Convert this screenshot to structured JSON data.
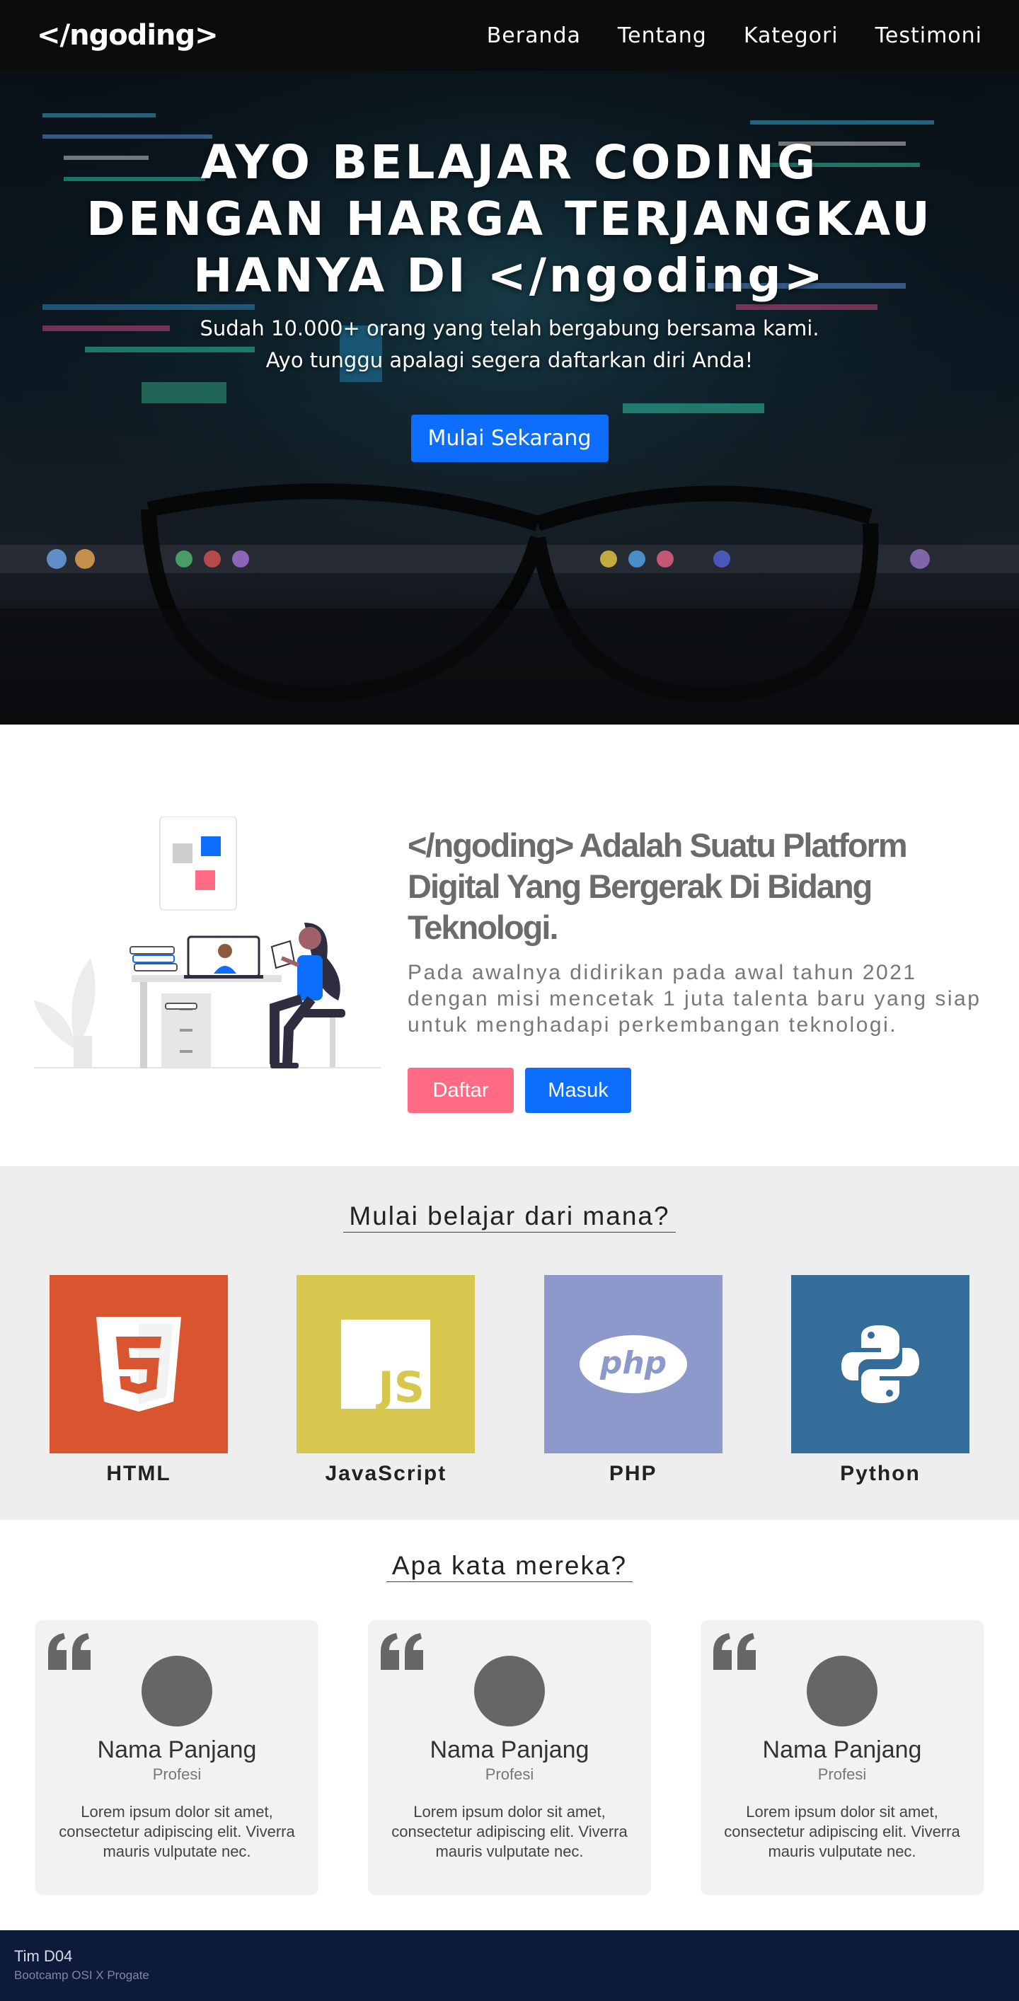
{
  "navbar": {
    "logo": "</ngoding>",
    "links": [
      "Beranda",
      "Tentang",
      "Kategori",
      "Testimoni"
    ]
  },
  "hero": {
    "title": "AYO BELAJAR CODING DENGAN HARGA TERJANGKAU HANYA DI </ngoding>",
    "subtitle_line1": "Sudah 10.000+ orang yang telah bergabung bersama kami.",
    "subtitle_line2": "Ayo tunggu apalagi segera daftarkan diri Anda!",
    "cta": "Mulai Sekarang"
  },
  "about": {
    "brand": "</ngoding>",
    "heading": " Adalah Suatu Platform Digital Yang Bergerak Di Bidang Teknologi.",
    "description": "Pada awalnya didirikan pada awal tahun 2021 dengan misi mencetak 1 juta talenta baru yang siap untuk menghadapi perkembangan teknologi.",
    "daftar": "Daftar",
    "masuk": "Masuk"
  },
  "categories": {
    "title": "Mulai belajar dari mana?",
    "items": [
      {
        "label": "HTML",
        "icon": "html5-icon",
        "color": "#d9552f"
      },
      {
        "label": "JavaScript",
        "icon": "javascript-icon",
        "color": "#d7c74f"
      },
      {
        "label": "PHP",
        "icon": "php-icon",
        "color": "#8d99cb"
      },
      {
        "label": "Python",
        "icon": "python-icon",
        "color": "#346c9a"
      }
    ]
  },
  "testimonials": {
    "title": "Apa kata mereka?",
    "items": [
      {
        "name": "Nama Panjang",
        "role": "Profesi",
        "text": "Lorem ipsum dolor sit amet, consectetur adipiscing elit. Viverra mauris vulputate nec."
      },
      {
        "name": "Nama Panjang",
        "role": "Profesi",
        "text": "Lorem ipsum dolor sit amet, consectetur adipiscing elit. Viverra mauris vulputate nec."
      },
      {
        "name": "Nama Panjang",
        "role": "Profesi",
        "text": "Lorem ipsum dolor sit amet, consectetur adipiscing elit. Viverra mauris vulputate nec."
      }
    ]
  },
  "footer": {
    "team": "Tim D04",
    "subtitle": "Bootcamp OSI X Progate"
  },
  "colors": {
    "navbar_bg": "#0c0c0c",
    "primary": "#0d6efd",
    "accent_pink": "#ff6b85",
    "footer_bg": "#0e1a3a"
  }
}
